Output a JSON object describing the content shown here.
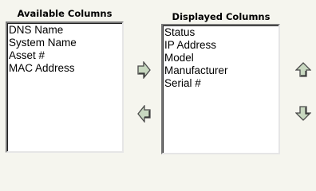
{
  "available": {
    "heading": "Available Columns",
    "items": [
      "DNS Name",
      "System Name",
      "Asset #",
      "MAC Address"
    ]
  },
  "displayed": {
    "heading": "Displayed Columns",
    "items": [
      "Status",
      "IP Address",
      "Model",
      "Manufacturer",
      "Serial #"
    ]
  },
  "controls": {
    "add_icon": "arrow-right-icon",
    "remove_icon": "arrow-left-icon",
    "move_up_icon": "arrow-up-icon",
    "move_down_icon": "arrow-down-icon",
    "arrow_fill": "#c8d8c0",
    "arrow_stroke": "#4a4a4a"
  }
}
